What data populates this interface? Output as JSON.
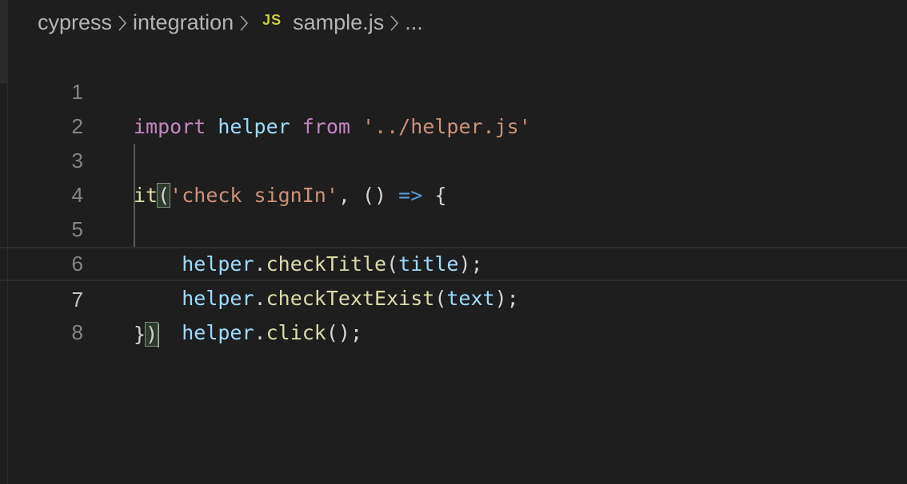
{
  "breadcrumb": {
    "items": [
      "cypress",
      "integration",
      "sample.js"
    ],
    "file_icon": "JS",
    "ellipsis": "..."
  },
  "code": {
    "line_numbers": [
      "1",
      "2",
      "3",
      "4",
      "5",
      "6",
      "7",
      "8"
    ],
    "line1": {
      "kw_import": "import",
      "helper": "helper",
      "kw_from": "from",
      "path": "'../helper.js'"
    },
    "line3": {
      "it": "it",
      "open_paren": "(",
      "test_name": "'check signIn'",
      "comma": ", ",
      "params": "()",
      "arrow": "=>",
      "brace": "{"
    },
    "line4": {
      "obj": "helper",
      "dot": ".",
      "method": "checkTitle",
      "open": "(",
      "arg": "title",
      "close": ");"
    },
    "line5": {
      "obj": "helper",
      "dot": ".",
      "method": "checkTextExist",
      "open": "(",
      "arg": "text",
      "close": ");"
    },
    "line6": {
      "obj": "helper",
      "dot": ".",
      "method": "click",
      "close": "();"
    },
    "line7": {
      "brace": "}",
      "paren": ")"
    }
  },
  "colors": {
    "background": "#1e1e1e",
    "keyword": "#c586c0",
    "variable": "#9cdcfe",
    "string": "#ce9178",
    "function": "#dcdcaa",
    "js_icon": "#cbcb41"
  },
  "icons": {
    "breadcrumb_separator": "chevron-right-icon",
    "file_type": "javascript-file-icon"
  }
}
